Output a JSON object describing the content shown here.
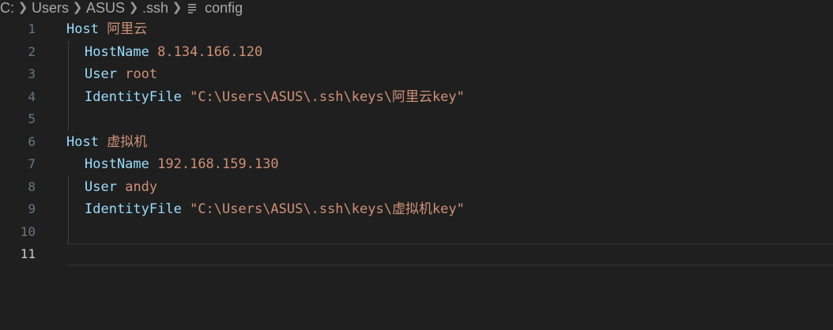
{
  "breadcrumb": {
    "segments": [
      "C:",
      "Users",
      "ASUS",
      ".ssh"
    ],
    "file_icon": "lines-file-icon",
    "file_name": "config"
  },
  "editor": {
    "active_line": 11,
    "lines": [
      {
        "num": "1",
        "key": "Host",
        "value": "阿里云"
      },
      {
        "num": "2",
        "key": "HostName",
        "value": "8.134.166.120"
      },
      {
        "num": "3",
        "key": "User",
        "value": "root"
      },
      {
        "num": "4",
        "key": "IdentityFile",
        "value": "\"C:\\Users\\ASUS\\.ssh\\keys\\阿里云key\""
      },
      {
        "num": "5",
        "key": "",
        "value": ""
      },
      {
        "num": "6",
        "key": "Host",
        "value": "虚拟机"
      },
      {
        "num": "7",
        "key": "HostName",
        "value": "192.168.159.130"
      },
      {
        "num": "8",
        "key": "User",
        "value": "andy"
      },
      {
        "num": "9",
        "key": "IdentityFile",
        "value": "\"C:\\Users\\ASUS\\.ssh\\keys\\虚拟机key\""
      },
      {
        "num": "10",
        "key": "",
        "value": ""
      },
      {
        "num": "11",
        "key": "",
        "value": ""
      }
    ]
  },
  "colors": {
    "background": "#1f1f1f",
    "keyword": "#9cdcfe",
    "value": "#ce9178",
    "line_number": "#6e7681",
    "line_number_active": "#cccccc"
  }
}
